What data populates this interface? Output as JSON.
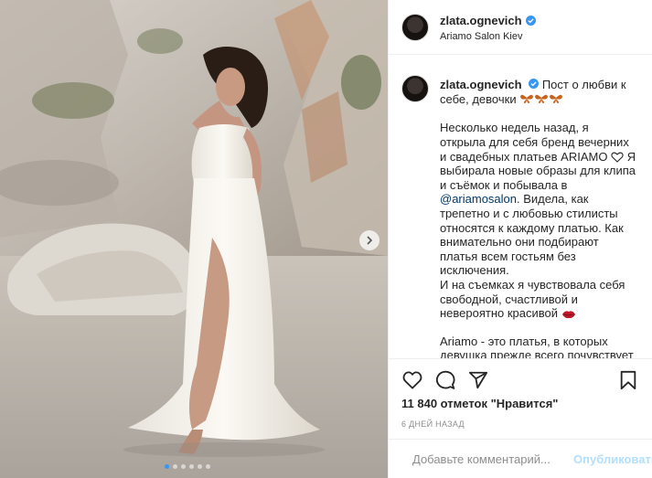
{
  "post": {
    "username": "zlata.ognevich",
    "location": "Ariamo Salon Kiev",
    "verified": true
  },
  "caption": {
    "username": "zlata.ognevich",
    "line1": "Пост о любви к себе, девочки",
    "para1_a": "Несколько недель назад, я открыла для себя бренд вечерних и свадебных платьев ARIAMO",
    "para1_b": "Я выбирала новые образы для клипа и съёмок и побывала в",
    "mention": "@ariamosalon",
    "para1_c": ". Видела, как трепетно и с любовью стилисты относятся к каждому платью. Как внимательно они подбирают платья всем гостьям без исключения.",
    "para2": "И на съемках я чувствовала себя свободной, счастливой и невероятно красивой",
    "para3": "Ariamo - это платья, в которых девушка прежде всего почувствует себя СОБОЙ."
  },
  "icons": {
    "like": "heart-icon",
    "comment": "comment-icon",
    "share": "paper-plane-icon",
    "save": "bookmark-icon",
    "emoji": "smiley-icon",
    "next": "chevron-right-icon"
  },
  "stats": {
    "likes_text": "11 840 отметок \"Нравится\"",
    "time_text": "6 ДНЕЙ НАЗАД"
  },
  "comment": {
    "placeholder": "Добавьте комментарий...",
    "publish_label": "Опубликовать"
  },
  "carousel": {
    "slides": 6,
    "active": 1
  },
  "colors": {
    "accent": "#0095f6",
    "publish_disabled": "#b2dffc",
    "mention": "#00376b",
    "muted": "#8e8e8e"
  }
}
